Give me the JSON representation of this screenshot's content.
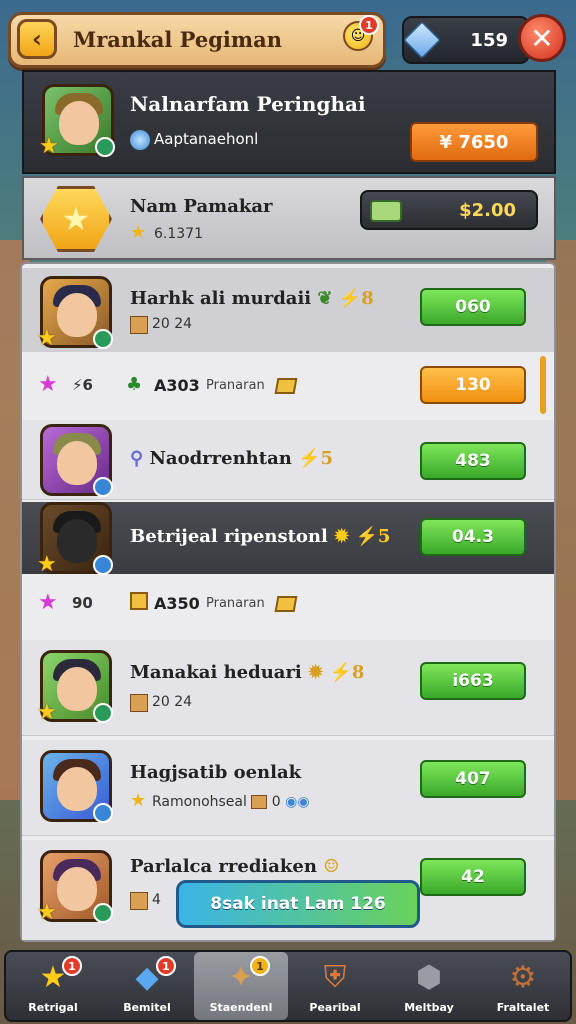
{
  "header": {
    "title": "Mrankal Pegiman",
    "title_badge_count": "1",
    "gem_value": "159",
    "back_icon": "chevron-left-icon",
    "close_icon": "close-x-icon"
  },
  "profile": {
    "name": "Nalnarfam Peringhai",
    "subtitle": "Aaptanaehonl",
    "price": "¥ 7650"
  },
  "gold_row": {
    "name": "Nam Pamakar",
    "subtitle": "6.1371",
    "value": "$2.00"
  },
  "rows": [
    {
      "name": "Harhk ali murdaii",
      "extra": "⚡8",
      "sub": "20 24",
      "button": "060",
      "style": "gray"
    },
    {
      "mini": true,
      "left": "⚡6",
      "code": "A303",
      "label": "Pranaran",
      "button": "130"
    },
    {
      "name": "Naodrrenhtan",
      "extra": "⚡5",
      "sub": "",
      "button": "483",
      "style": "card"
    },
    {
      "name": "Betrijeal ripenstonl",
      "extra": "⚡5",
      "sub": "",
      "button": "04.3",
      "style": "dark"
    },
    {
      "mini": true,
      "left": "90",
      "code": "A350",
      "label": "Pranaran"
    },
    {
      "name": "Manakai heduari",
      "extra": "⚡8",
      "sub": "20 24",
      "button": "i663",
      "style": "card"
    },
    {
      "name": "Hagjsatib oenlak",
      "extra": "",
      "sub": "Ramonohseal",
      "sub2": "0",
      "button": "407",
      "style": "card"
    },
    {
      "name": "Parlalca rrediaken",
      "extra": "",
      "sub": "4",
      "button": "42",
      "style": "card"
    }
  ],
  "floating_chip": "8sak inat Lam 126",
  "nav": [
    {
      "label": "Retrigal",
      "badge": "1",
      "icon": "star-icon"
    },
    {
      "label": "Bemitel",
      "badge": "1",
      "icon": "gem-icon"
    },
    {
      "label": "Staendenl",
      "badge": "1",
      "icon": "cat-icon",
      "active": true
    },
    {
      "label": "Pearibal",
      "badge": "",
      "icon": "shield-icon"
    },
    {
      "label": "Meltbay",
      "badge": "",
      "icon": "badge-icon"
    },
    {
      "label": "Fraltalet",
      "badge": "",
      "icon": "gear-icon"
    }
  ],
  "colors": {
    "accent_orange": "#f09010",
    "accent_green": "#3aa82a",
    "plate_gold": "#e6b877",
    "close_red": "#d1301f"
  }
}
